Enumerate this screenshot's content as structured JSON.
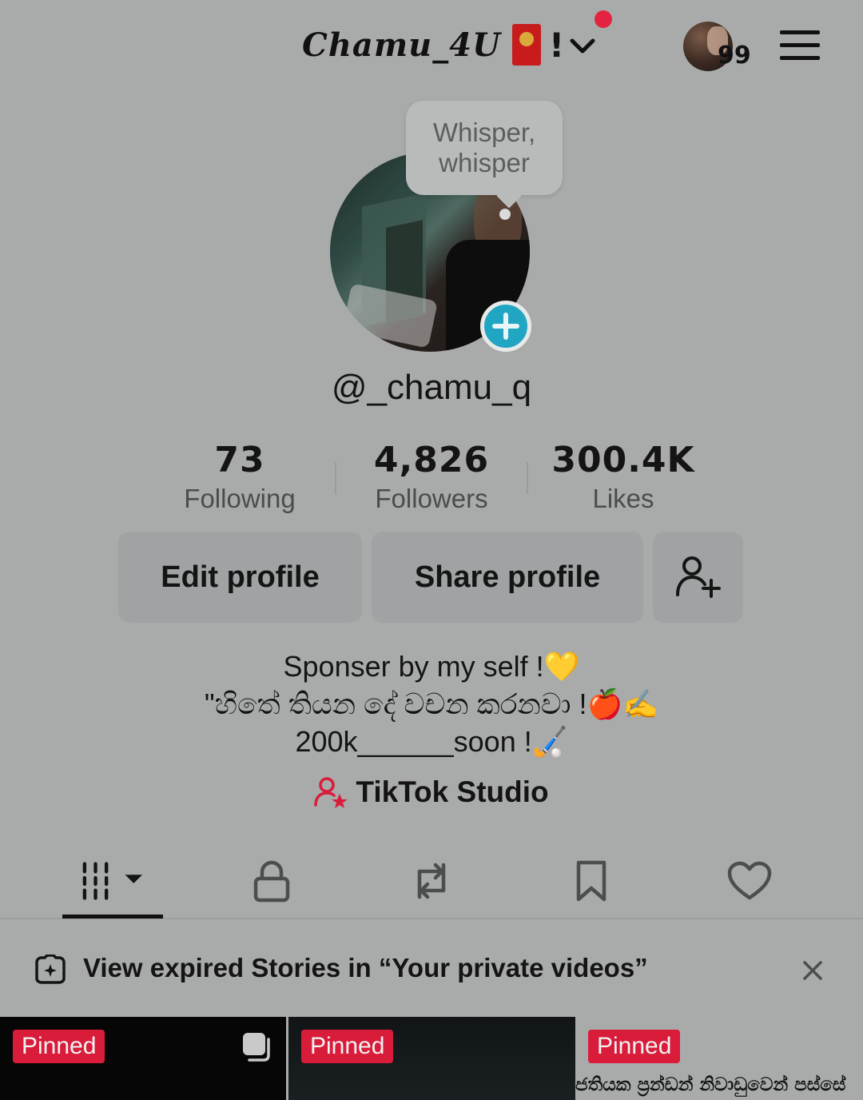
{
  "header": {
    "account_name": "Chamu_4U",
    "title_suffix": "!",
    "notification_count": "99"
  },
  "profile": {
    "bubble_text": "Whisper, whisper",
    "username": "@_chamu_q"
  },
  "stats": [
    {
      "value": "73",
      "label": "Following"
    },
    {
      "value": "4,826",
      "label": "Followers"
    },
    {
      "value": "300.4K",
      "label": "Likes"
    }
  ],
  "buttons": {
    "edit_profile": "Edit profile",
    "share_profile": "Share profile"
  },
  "bio": {
    "line1": "Sponser by my self !💛",
    "line2": "\"හිතේ තියන දේ වචන කරනවා !🍎✍",
    "line3": "200k______soon !🏑"
  },
  "studio": {
    "label": "TikTok Studio"
  },
  "tabs": [
    {
      "icon": "videos-grid-icon"
    },
    {
      "icon": "lock-icon"
    },
    {
      "icon": "repost-icon"
    },
    {
      "icon": "bookmark-icon"
    },
    {
      "icon": "heart-icon"
    }
  ],
  "banner": {
    "text": "View expired Stories in “Your private videos”"
  },
  "grid": [
    {
      "badge": "Pinned"
    },
    {
      "badge": "Pinned"
    },
    {
      "badge": "Pinned",
      "caption": "ජතියක ප්‍රන්ඩන් නිවාඩුවෙන් පස්සේ"
    }
  ],
  "colors": {
    "background": "#a9abab",
    "accent_red": "#d81c3a",
    "accent_cyan": "#20a5c2"
  }
}
